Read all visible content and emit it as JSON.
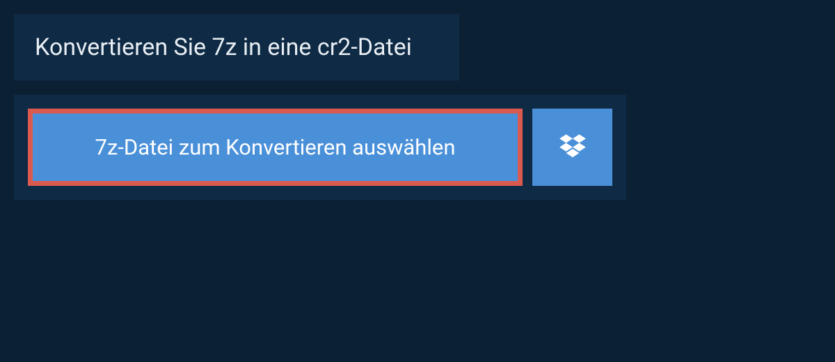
{
  "header": {
    "title": "Konvertieren Sie 7z in eine cr2-Datei"
  },
  "actions": {
    "select_file_label": "7z-Datei zum Konvertieren auswählen",
    "dropbox_icon_name": "dropbox-icon"
  },
  "colors": {
    "background": "#0c2034",
    "panel": "#0f2a44",
    "button": "#4a90d9",
    "highlight_border": "#da5a4f",
    "text_light": "#e8eef4",
    "text_white": "#ffffff"
  }
}
